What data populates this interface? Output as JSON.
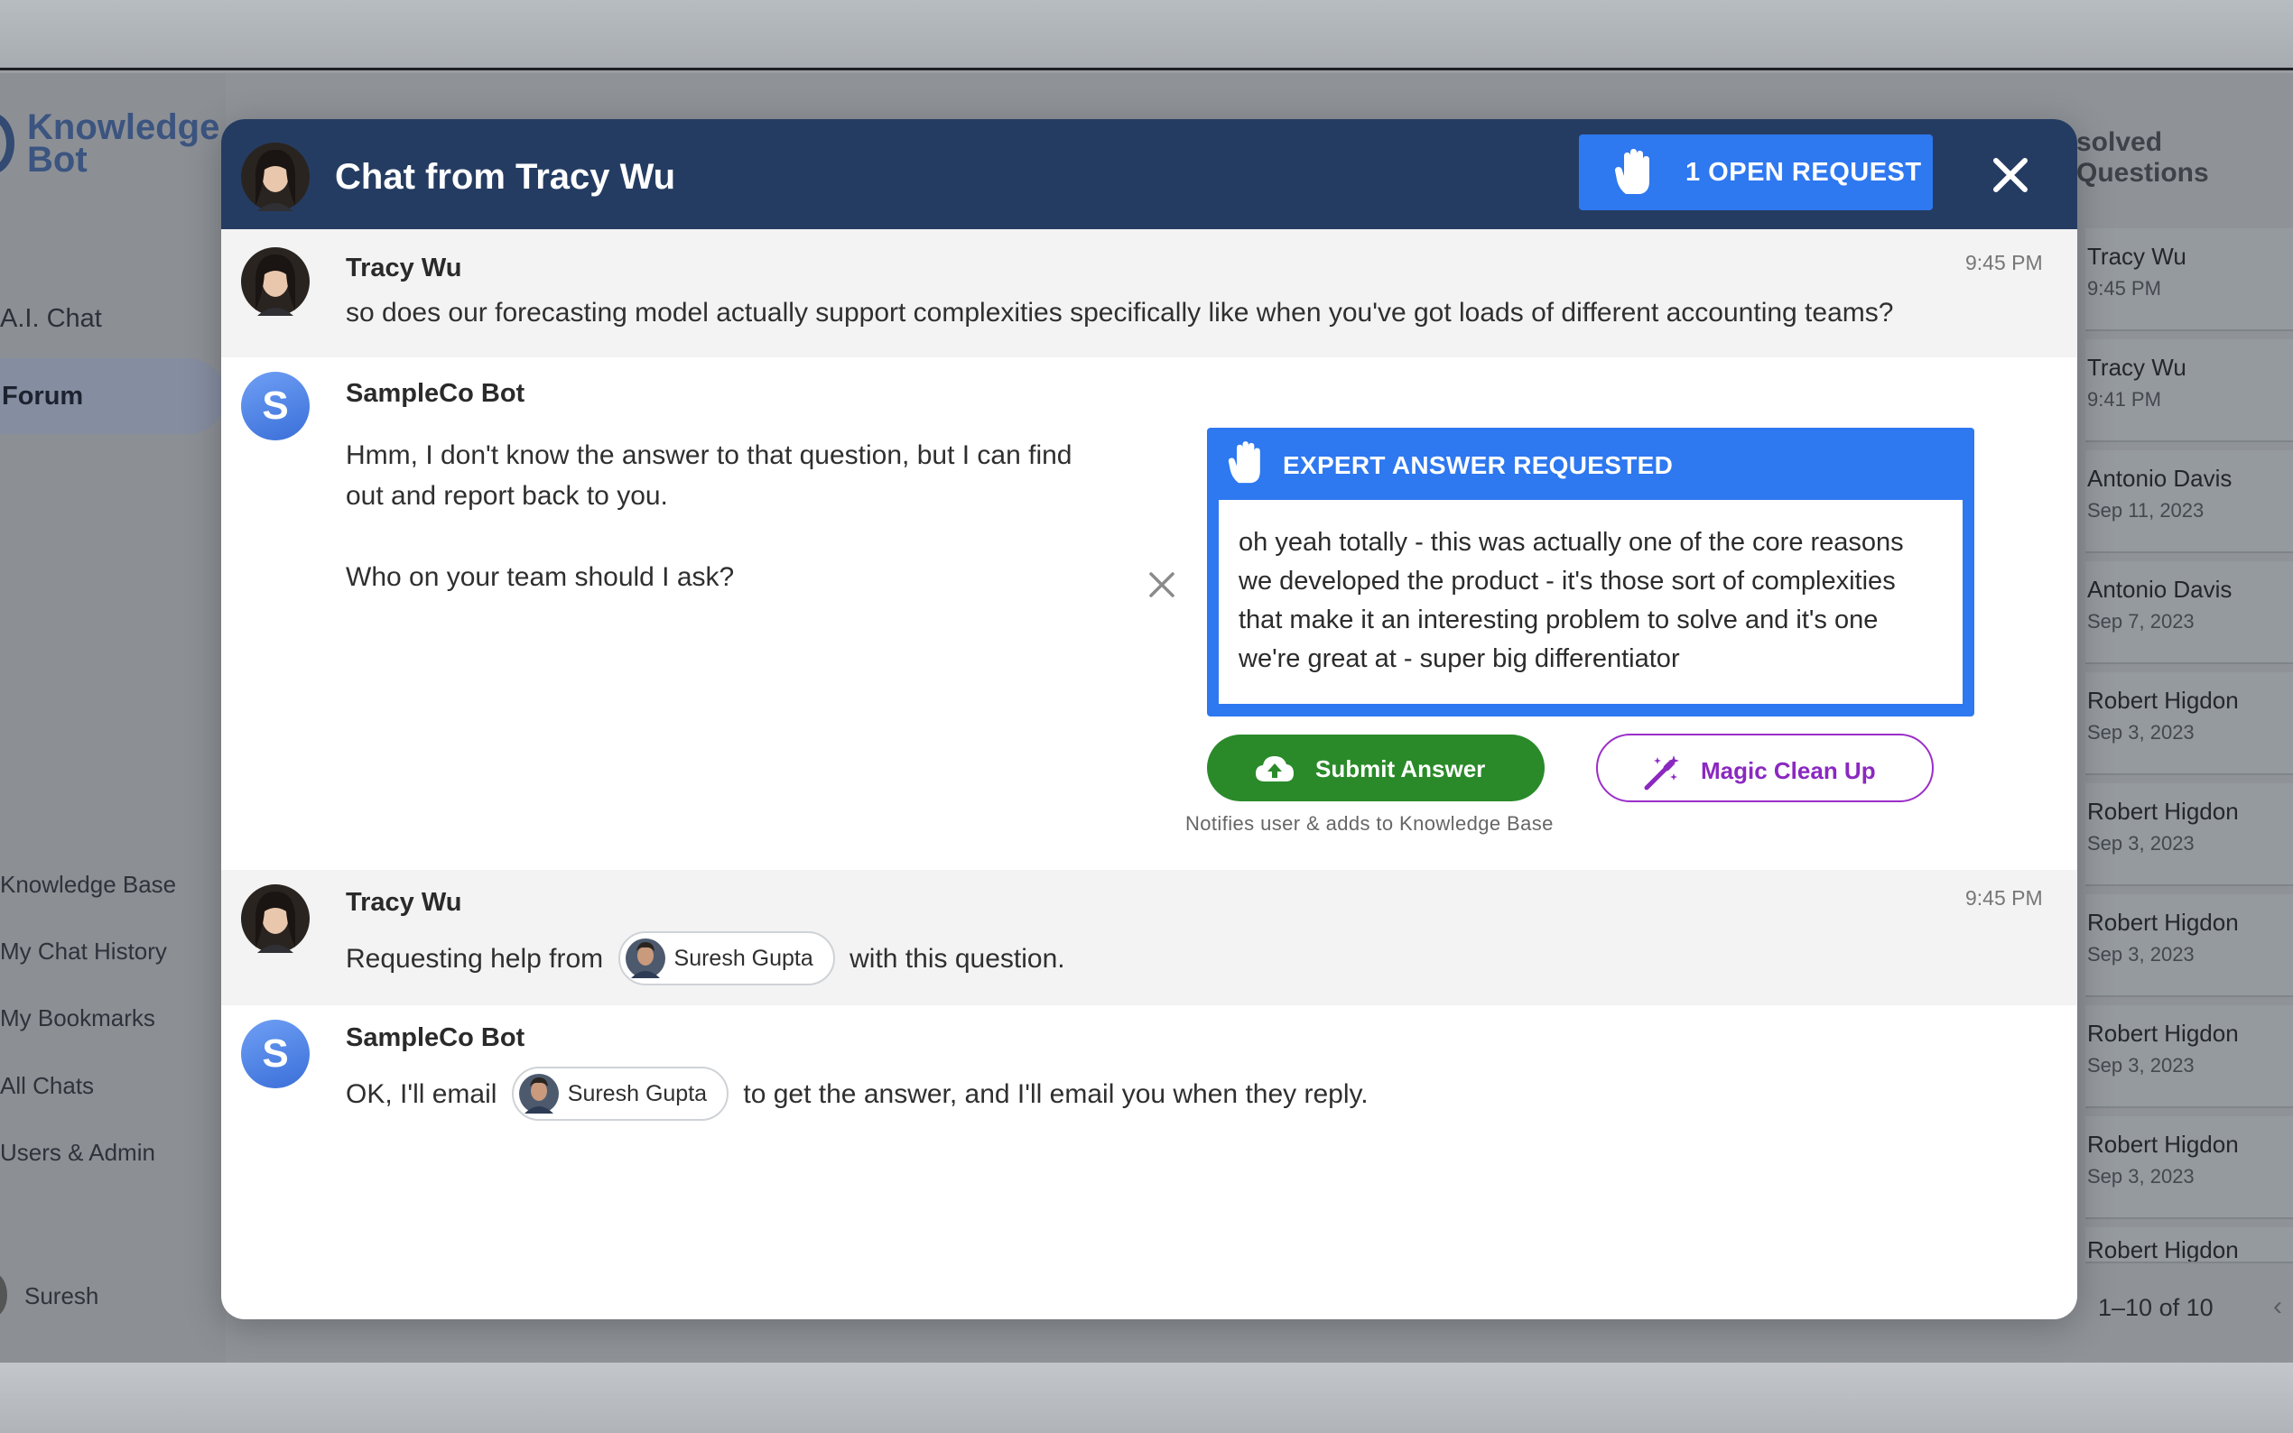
{
  "app": {
    "logo_line1": "Knowledge",
    "logo_line2": "Bot",
    "nav": {
      "ai_chat": "A.I. Chat",
      "forum": "Forum",
      "knowledge_base": "Knowledge Base",
      "my_chat_history": "My Chat History",
      "my_bookmarks": "My Bookmarks",
      "all_chats": "All Chats",
      "users_admin": "Users & Admin"
    },
    "current_user": "Suresh"
  },
  "right_panel": {
    "heading": "solved Questions",
    "rows": [
      {
        "name": "Tracy Wu",
        "date": "9:45 PM"
      },
      {
        "name": "Tracy Wu",
        "date": "9:41 PM"
      },
      {
        "name": "Antonio Davis",
        "date": "Sep 11, 2023"
      },
      {
        "name": "Antonio Davis",
        "date": "Sep 7, 2023"
      },
      {
        "name": "Robert Higdon",
        "date": "Sep 3, 2023"
      },
      {
        "name": "Robert Higdon",
        "date": "Sep 3, 2023"
      },
      {
        "name": "Robert Higdon",
        "date": "Sep 3, 2023"
      },
      {
        "name": "Robert Higdon",
        "date": "Sep 3, 2023"
      },
      {
        "name": "Robert Higdon",
        "date": "Sep 3, 2023"
      },
      {
        "name": "Robert Higdon",
        "date": ""
      }
    ],
    "pager": "1–10 of 10"
  },
  "modal": {
    "title": "Chat from Tracy Wu",
    "open_request_label": "1 OPEN REQUEST",
    "messages": [
      {
        "author": "Tracy Wu",
        "time": "9:45 PM",
        "text": "so does our forecasting model actually support complexities specifically like when you've got loads of different accounting teams?"
      },
      {
        "author": "SampleCo Bot",
        "avatar_letter": "S",
        "text_line1": "Hmm, I don't know the answer to that question, but I can find",
        "text_line2": "out and report back to you.",
        "text_line3": "Who on your team should I ask?"
      },
      {
        "author": "Tracy Wu",
        "time": "9:45 PM",
        "text_before": "Requesting help from",
        "chip": "Suresh Gupta",
        "text_after": "with this question."
      },
      {
        "author": "SampleCo Bot",
        "avatar_letter": "S",
        "text_before": "OK, I'll email",
        "chip": "Suresh Gupta",
        "text_after": "to get the answer, and I'll email you when they reply."
      }
    ],
    "expert": {
      "title": "EXPERT ANSWER REQUESTED",
      "answer": "oh yeah totally - this was actually one of the core reasons we developed the product - it's those sort of complexities that make it an interesting problem to solve and it's one we're great at - super big differentiator"
    },
    "submit_label": "Submit Answer",
    "submit_note": "Notifies user & adds to Knowledge Base",
    "magic_label": "Magic Clean Up"
  },
  "colors": {
    "header_bg": "#253c62",
    "accent_blue": "#2e78f0",
    "submit_green": "#2a8a2a",
    "magic_purple": "#9b2ec9"
  }
}
